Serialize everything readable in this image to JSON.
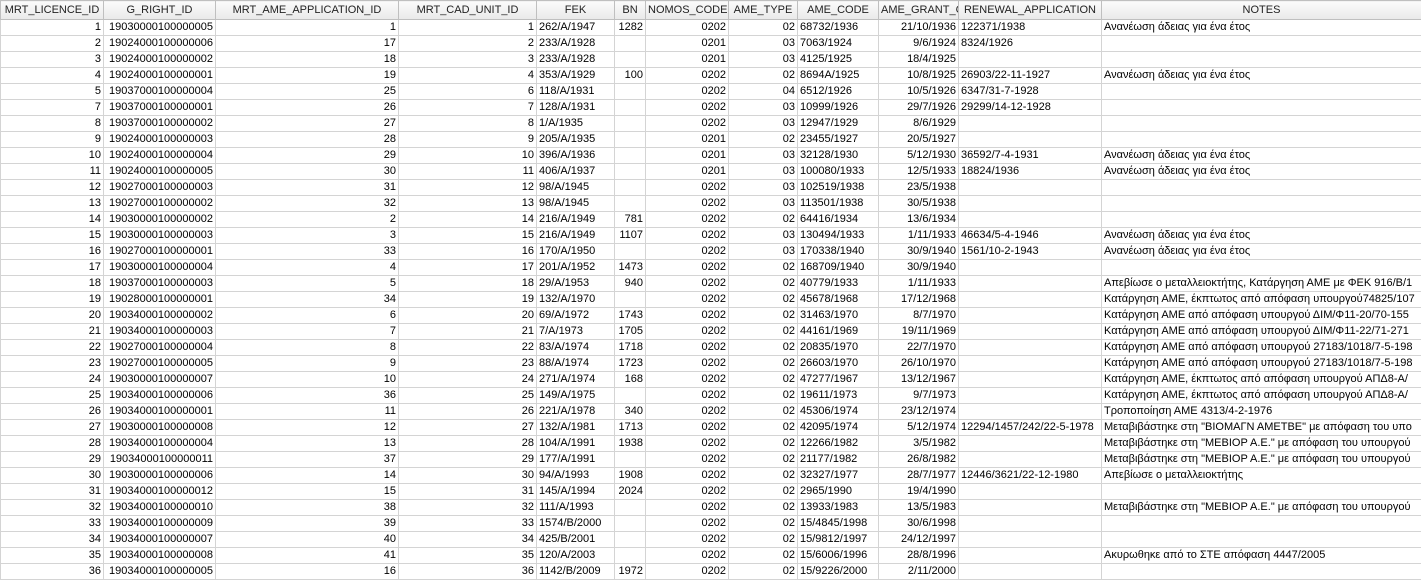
{
  "columns": [
    {
      "key": "licence_id",
      "label": "MRT_LICENCE_ID",
      "align": "num"
    },
    {
      "key": "g_right_id",
      "label": "G_RIGHT_ID",
      "align": "num"
    },
    {
      "key": "ame_application_id",
      "label": "MRT_AME_APPLICATION_ID",
      "align": "num"
    },
    {
      "key": "cad_unit_id",
      "label": "MRT_CAD_UNIT_ID",
      "align": "num"
    },
    {
      "key": "fek",
      "label": "FEK",
      "align": "txt"
    },
    {
      "key": "bn",
      "label": "BN",
      "align": "num"
    },
    {
      "key": "nomos_code",
      "label": "NOMOS_CODE",
      "align": "num"
    },
    {
      "key": "ame_type",
      "label": "AME_TYPE",
      "align": "num"
    },
    {
      "key": "ame_code",
      "label": "AME_CODE",
      "align": "txt"
    },
    {
      "key": "ame_grant",
      "label": "AME_GRANT_C",
      "align": "num"
    },
    {
      "key": "renewal",
      "label": "RENEWAL_APPLICATION",
      "align": "txt"
    },
    {
      "key": "notes",
      "label": "NOTES",
      "align": "txt"
    }
  ],
  "rows": [
    [
      "1",
      "19030000100000005",
      "1",
      "1",
      "262/A/1947",
      "1282",
      "0202",
      "02",
      "68732/1936",
      "21/10/1936",
      "122371/1938",
      "Ανανέωση άδειας για ένα έτος"
    ],
    [
      "2",
      "19024000100000006",
      "17",
      "2",
      "233/A/1928",
      "",
      "0201",
      "03",
      "7063/1924",
      "9/6/1924",
      "8324/1926",
      ""
    ],
    [
      "3",
      "19024000100000002",
      "18",
      "3",
      "233/A/1928",
      "",
      "0201",
      "03",
      "4125/1925",
      "18/4/1925",
      "",
      ""
    ],
    [
      "4",
      "19024000100000001",
      "19",
      "4",
      "353/A/1929",
      "100",
      "0202",
      "02",
      "8694A/1925",
      "10/8/1925",
      "26903/22-11-1927",
      "Ανανέωση άδειας για ένα έτος"
    ],
    [
      "5",
      "19037000100000004",
      "25",
      "6",
      "118/A/1931",
      "",
      "0202",
      "04",
      "6512/1926",
      "10/5/1926",
      "6347/31-7-1928",
      ""
    ],
    [
      "7",
      "19037000100000001",
      "26",
      "7",
      "128/A/1931",
      "",
      "0202",
      "03",
      "10999/1926",
      "29/7/1926",
      "29299/14-12-1928",
      ""
    ],
    [
      "8",
      "19037000100000002",
      "27",
      "8",
      "1/A/1935",
      "",
      "0202",
      "03",
      "12947/1929",
      "8/6/1929",
      "",
      ""
    ],
    [
      "9",
      "19024000100000003",
      "28",
      "9",
      "205/A/1935",
      "",
      "0201",
      "02",
      "23455/1927",
      "20/5/1927",
      "",
      ""
    ],
    [
      "10",
      "19024000100000004",
      "29",
      "10",
      "396/A/1936",
      "",
      "0201",
      "03",
      "32128/1930",
      "5/12/1930",
      "36592/7-4-1931",
      "Ανανέωση άδειας για ένα έτος"
    ],
    [
      "11",
      "19024000100000005",
      "30",
      "11",
      "406/A/1937",
      "",
      "0201",
      "03",
      "100080/1933",
      "12/5/1933",
      "18824/1936",
      "Ανανέωση άδειας για ένα έτος"
    ],
    [
      "12",
      "19027000100000003",
      "31",
      "12",
      "98/A/1945",
      "",
      "0202",
      "03",
      "102519/1938",
      "23/5/1938",
      "",
      ""
    ],
    [
      "13",
      "19027000100000002",
      "32",
      "13",
      "98/A/1945",
      "",
      "0202",
      "03",
      "113501/1938",
      "30/5/1938",
      "",
      ""
    ],
    [
      "14",
      "19030000100000002",
      "2",
      "14",
      "216/A/1949",
      "781",
      "0202",
      "02",
      "64416/1934",
      "13/6/1934",
      "",
      ""
    ],
    [
      "15",
      "19030000100000003",
      "3",
      "15",
      "216/A/1949",
      "1107",
      "0202",
      "03",
      "130494/1933",
      "1/11/1933",
      "46634/5-4-1946",
      "Ανανέωση άδειας για ένα έτος"
    ],
    [
      "16",
      "19027000100000001",
      "33",
      "16",
      "170/A/1950",
      "",
      "0202",
      "03",
      "170338/1940",
      "30/9/1940",
      "1561/10-2-1943",
      "Ανανέωση άδειας για ένα έτος"
    ],
    [
      "17",
      "19030000100000004",
      "4",
      "17",
      "201/A/1952",
      "1473",
      "0202",
      "02",
      "168709/1940",
      "30/9/1940",
      "",
      ""
    ],
    [
      "18",
      "19037000100000003",
      "5",
      "18",
      "29/A/1953",
      "940",
      "0202",
      "02",
      "40779/1933",
      "1/11/1933",
      "",
      "Απεβίωσε ο μεταλλειοκτήτης, Κατάργηση ΑΜΕ με ΦΕΚ 916/Β/1"
    ],
    [
      "19",
      "19028000100000001",
      "34",
      "19",
      "132/A/1970",
      "",
      "0202",
      "02",
      "45678/1968",
      "17/12/1968",
      "",
      "Κατάργηση ΑΜΕ, έκπτωτος από απόφαση υπουργού74825/107"
    ],
    [
      "20",
      "19034000100000002",
      "6",
      "20",
      "69/A/1972",
      "1743",
      "0202",
      "02",
      "31463/1970",
      "8/7/1970",
      "",
      "Κατάργηση ΑΜΕ από απόφαση υπουργού ΔΙΜ/Φ11-20/70-155"
    ],
    [
      "21",
      "19034000100000003",
      "7",
      "21",
      "7/A/1973",
      "1705",
      "0202",
      "02",
      "44161/1969",
      "19/11/1969",
      "",
      "Κατάργηση ΑΜΕ από απόφαση υπουργού ΔΙΜ/Φ11-22/71-271"
    ],
    [
      "22",
      "19027000100000004",
      "8",
      "22",
      "83/A/1974",
      "1718",
      "0202",
      "02",
      "20835/1970",
      "22/7/1970",
      "",
      "Κατάργηση ΑΜΕ από απόφαση υπουργού 27183/1018/7-5-198"
    ],
    [
      "23",
      "19027000100000005",
      "9",
      "23",
      "88/A/1974",
      "1723",
      "0202",
      "02",
      "26603/1970",
      "26/10/1970",
      "",
      "Κατάργηση ΑΜΕ από απόφαση υπουργού 27183/1018/7-5-198"
    ],
    [
      "24",
      "19030000100000007",
      "10",
      "24",
      "271/A/1974",
      "168",
      "0202",
      "02",
      "47277/1967",
      "13/12/1967",
      "",
      "Κατάργηση ΑΜΕ, έκπτωτος από απόφαση υπουργού ΑΠΔ8-Α/"
    ],
    [
      "25",
      "19034000100000006",
      "36",
      "25",
      "149/A/1975",
      "",
      "0202",
      "02",
      "19611/1973",
      "9/7/1973",
      "",
      "Κατάργηση ΑΜΕ, έκπτωτος από απόφαση υπουργού ΑΠΔ8-Α/"
    ],
    [
      "26",
      "19034000100000001",
      "11",
      "26",
      "221/A/1978",
      "340",
      "0202",
      "02",
      "45306/1974",
      "23/12/1974",
      "",
      "Τροποποίηση ΑΜΕ 4313/4-2-1976"
    ],
    [
      "27",
      "19030000100000008",
      "12",
      "27",
      "132/A/1981",
      "1713",
      "0202",
      "02",
      "42095/1974",
      "5/12/1974",
      "12294/1457/242/22-5-1978",
      "Μεταβιβάστηκε στη \"ΒΙΟΜΑΓΝ ΑΜΕΤΒΕ\" με απόφαση του υπο"
    ],
    [
      "28",
      "19034000100000004",
      "13",
      "28",
      "104/A/1991",
      "1938",
      "0202",
      "02",
      "12266/1982",
      "3/5/1982",
      "",
      "Μεταβιβάστηκε στη \"ΜΕΒΙΟΡ Α.Ε.\" με απόφαση του υπουργού"
    ],
    [
      "29",
      "19034000100000011",
      "37",
      "29",
      "177/A/1991",
      "",
      "0202",
      "02",
      "21177/1982",
      "26/8/1982",
      "",
      "Μεταβιβάστηκε στη \"ΜΕΒΙΟΡ Α.Ε.\" με απόφαση του υπουργού"
    ],
    [
      "30",
      "19030000100000006",
      "14",
      "30",
      "94/A/1993",
      "1908",
      "0202",
      "02",
      "32327/1977",
      "28/7/1977",
      "12446/3621/22-12-1980",
      "Απεβίωσε ο μεταλλειοκτήτης"
    ],
    [
      "31",
      "19034000100000012",
      "15",
      "31",
      "145/A/1994",
      "2024",
      "0202",
      "02",
      "2965/1990",
      "19/4/1990",
      "",
      ""
    ],
    [
      "32",
      "19034000100000010",
      "38",
      "32",
      "111/A/1993",
      "",
      "0202",
      "02",
      "13933/1983",
      "13/5/1983",
      "",
      "Μεταβιβάστηκε στη \"ΜΕΒΙΟΡ Α.Ε.\" με απόφαση του υπουργού"
    ],
    [
      "33",
      "19034000100000009",
      "39",
      "33",
      "1574/B/2000",
      "",
      "0202",
      "02",
      "15/4845/1998",
      "30/6/1998",
      "",
      ""
    ],
    [
      "34",
      "19034000100000007",
      "40",
      "34",
      "425/B/2001",
      "",
      "0202",
      "02",
      "15/9812/1997",
      "24/12/1997",
      "",
      ""
    ],
    [
      "35",
      "19034000100000008",
      "41",
      "35",
      "120/A/2003",
      "",
      "0202",
      "02",
      "15/6006/1996",
      "28/8/1996",
      "",
      "Ακυρωθηκε από το ΣΤΕ απόφαση 4447/2005"
    ],
    [
      "36",
      "19034000100000005",
      "16",
      "36",
      "1142/B/2009",
      "1972",
      "0202",
      "02",
      "15/9226/2000",
      "2/11/2000",
      "",
      ""
    ]
  ]
}
